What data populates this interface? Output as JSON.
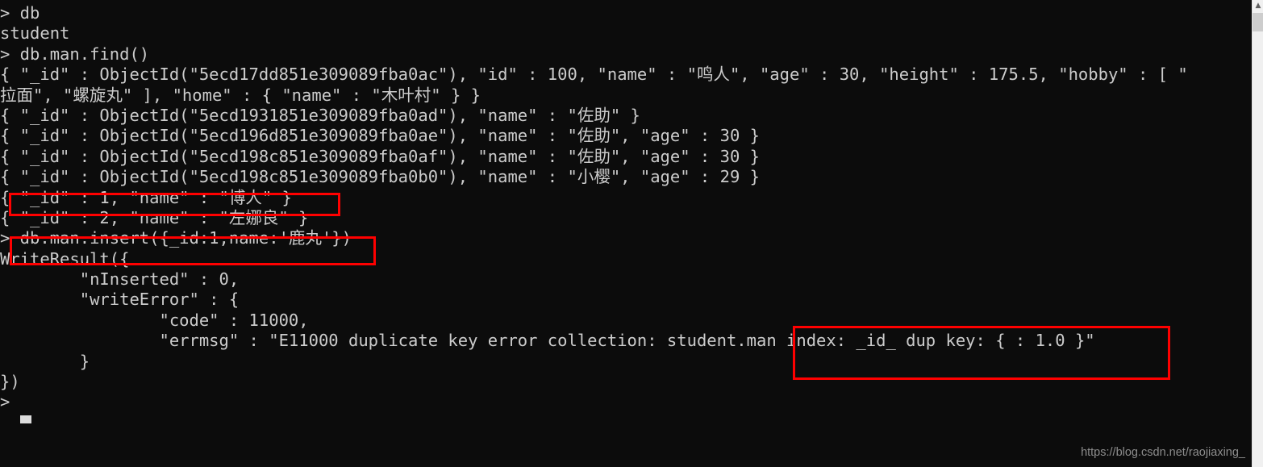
{
  "terminal": {
    "title": "mongo shell",
    "background_color": "#0c0c0c",
    "text_color": "#cccccc",
    "annotation_color": "#ff0000",
    "lines": [
      "> db",
      "student",
      "> db.man.find()",
      "{ \"_id\" : ObjectId(\"5ecd17dd851e309089fba0ac\"), \"id\" : 100, \"name\" : \"鸣人\", \"age\" : 30, \"height\" : 175.5, \"hobby\" : [ \"",
      "拉面\", \"螺旋丸\" ], \"home\" : { \"name\" : \"木叶村\" } }",
      "{ \"_id\" : ObjectId(\"5ecd1931851e309089fba0ad\"), \"name\" : \"佐助\" }",
      "{ \"_id\" : ObjectId(\"5ecd196d851e309089fba0ae\"), \"name\" : \"佐助\", \"age\" : 30 }",
      "{ \"_id\" : ObjectId(\"5ecd198c851e309089fba0af\"), \"name\" : \"佐助\", \"age\" : 30 }",
      "{ \"_id\" : ObjectId(\"5ecd198c851e309089fba0b0\"), \"name\" : \"小樱\", \"age\" : 29 }",
      "{ \"_id\" : 1, \"name\" : \"博人\" }",
      "{ \"_id\" : 2, \"name\" : \"左娜良\" }",
      "> db.man.insert({_id:1,name:'鹿丸'})",
      "WriteResult({",
      "        \"nInserted\" : 0,",
      "        \"writeError\" : {",
      "                \"code\" : 11000,",
      "                \"errmsg\" : \"E11000 duplicate key error collection: student.man index: _id_ dup key: { : 1.0 }\"",
      "        }",
      "})",
      ">"
    ],
    "cursor": "block"
  },
  "annotations": [
    {
      "id": "redbox-1",
      "label": "highlight-inserted-document-id-1",
      "target_text": "{ \"_id\" : 1, \"name\" : \"博人\" }"
    },
    {
      "id": "redbox-2",
      "label": "highlight-duplicate-insert-command",
      "target_text": "> db.man.insert({_id:1,name:'鹿丸'})"
    },
    {
      "id": "redbox-3",
      "label": "highlight-duplicate-key-error-detail",
      "target_text": "index: _id_ dup key: { : 1.0 }\""
    }
  ],
  "scrollbar": {
    "up_arrow_glyph": "▲",
    "thumb_label": "scrollbar-thumb"
  },
  "watermark": {
    "text": "https://blog.csdn.net/raojiaxing_"
  }
}
